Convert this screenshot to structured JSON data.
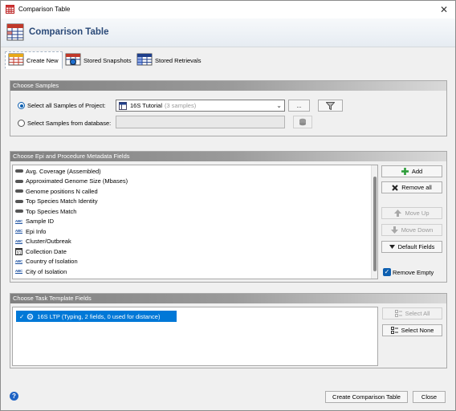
{
  "window": {
    "title": "Comparison Table",
    "close_symbol": "✕"
  },
  "header": {
    "title": "Comparison Table"
  },
  "tabs": [
    {
      "label": "Create New",
      "active": true
    },
    {
      "label": "Stored Snapshots",
      "active": false
    },
    {
      "label": "Stored Retrievals",
      "active": false
    }
  ],
  "samples": {
    "section_title": "Choose Samples",
    "project_option_label": "Select all Samples of Project:",
    "project_selected_name": "16S Tutorial",
    "project_selected_count": "(3 samples)",
    "browse_button": "...",
    "database_option_label": "Select Samples from database:",
    "database_value": ""
  },
  "metadata": {
    "section_title": "Choose Epi and Procedure Metadata Fields",
    "fields": [
      {
        "label": "Avg. Coverage (Assembled)",
        "icon": "numeric-field-icon"
      },
      {
        "label": "Approximated Genome Size (Mbases)",
        "icon": "numeric-field-icon"
      },
      {
        "label": "Genome positions N called",
        "icon": "numeric-field-icon"
      },
      {
        "label": "Top Species Match Identity",
        "icon": "numeric-field-icon"
      },
      {
        "label": "Top Species Match",
        "icon": "numeric-field-icon"
      },
      {
        "label": "Sample ID",
        "icon": "text-field-icon"
      },
      {
        "label": "Epi Info",
        "icon": "text-field-icon"
      },
      {
        "label": "Cluster/Outbreak",
        "icon": "text-field-icon"
      },
      {
        "label": "Collection Date",
        "icon": "date-field-icon"
      },
      {
        "label": "Country of Isolation",
        "icon": "text-field-icon"
      },
      {
        "label": "City of Isolation",
        "icon": "text-field-icon"
      }
    ],
    "buttons": {
      "add": "Add",
      "remove_all": "Remove all",
      "move_up": "Move Up",
      "move_down": "Move Down",
      "default_fields": "Default Fields"
    },
    "remove_empty_label": "Remove Empty",
    "remove_empty_checked": true
  },
  "task_template": {
    "section_title": "Choose Task Template Fields",
    "items": [
      {
        "label": "16S LTP (Typing, 2 fields, 0 used for distance)",
        "selected": true
      }
    ],
    "buttons": {
      "select_all": "Select All",
      "select_none": "Select None"
    }
  },
  "footer": {
    "help_symbol": "?",
    "create_button": "Create Comparison Table",
    "close_button": "Close"
  },
  "colors": {
    "accent": "#0078d7",
    "header_title": "#2b4a78",
    "section_bar": "#8a8a8a"
  }
}
